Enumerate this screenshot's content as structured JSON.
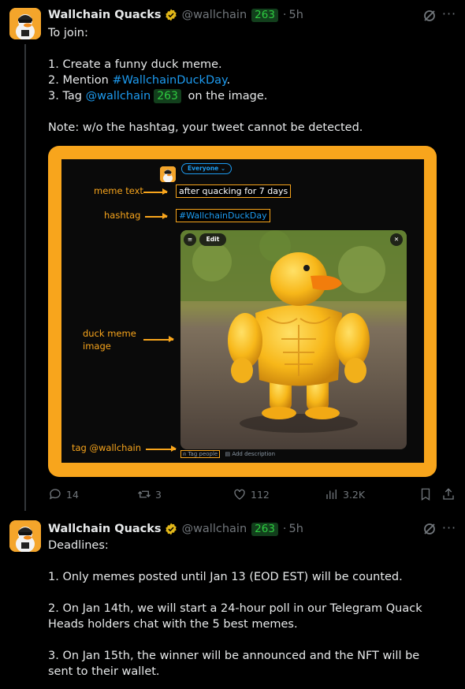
{
  "colors": {
    "accent": "#1d9bf0",
    "orange": "#f8a51c",
    "pill_bg": "#123f1c",
    "pill_fg": "#2ecc40",
    "muted": "#71767b"
  },
  "tweet1": {
    "author": {
      "name": "Wallchain Quacks",
      "handle": "@wallchain",
      "badge": "263",
      "time": "5h"
    },
    "lines": [
      "To join:",
      "",
      "1. Create a funny duck meme.",
      "2. Mention ",
      "#WallchainDuckDay",
      ".",
      "3. Tag ",
      "@wallchain",
      "263",
      "on the image.",
      "",
      "Note: w/o the hashtag, your tweet cannot be detected."
    ],
    "media": {
      "everyone_label": "Everyone",
      "meme_text_label": "meme text",
      "meme_text_value": "after quacking for 7 days",
      "hashtag_label": "hashtag",
      "hashtag_value": "#WallchainDuckDay",
      "duck_label_line1": "duck meme",
      "duck_label_line2": "image",
      "tag_label": "tag @wallchain",
      "edit_label": "Edit",
      "tag_people": "Tag people",
      "add_description": "Add description"
    },
    "actions": {
      "replies": "14",
      "reposts": "3",
      "likes": "112",
      "views": "3.2K"
    }
  },
  "tweet2": {
    "author": {
      "name": "Wallchain Quacks",
      "handle": "@wallchain",
      "badge": "263",
      "time": "5h"
    },
    "lines": [
      "Deadlines:",
      "",
      "1. Only memes posted until Jan 13 (EOD EST) will be counted.",
      "",
      "2. On Jan 14th, we will start a 24-hour poll in our Telegram Quack Heads holders chat with the 5 best memes.",
      "",
      "3. On Jan 15th, the winner will be announced and the NFT will be sent to their wallet."
    ]
  }
}
